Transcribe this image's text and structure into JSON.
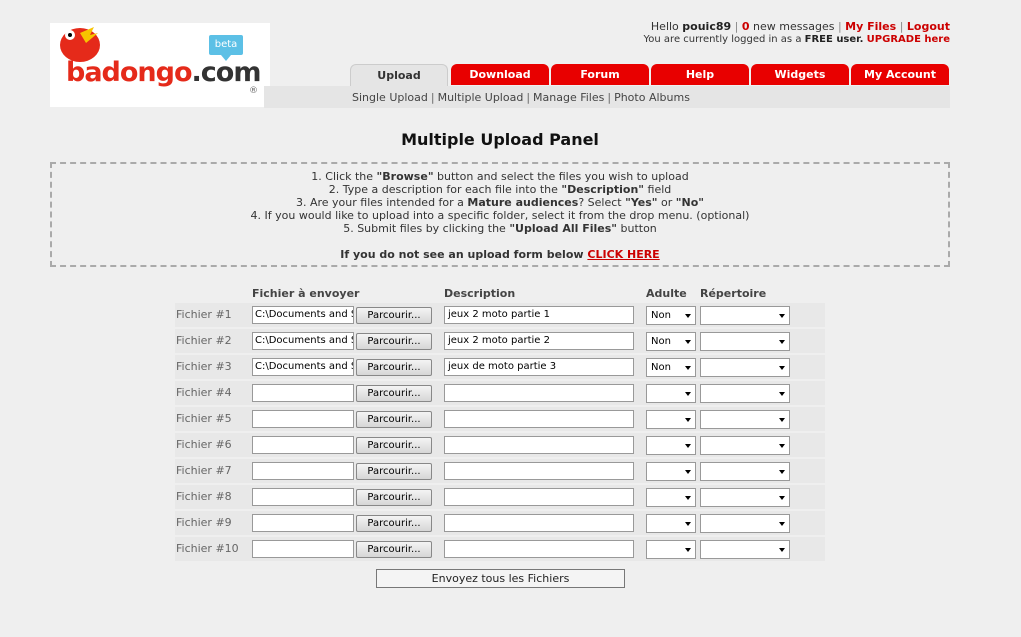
{
  "logo": {
    "text": "badongo",
    "suffix": ".com",
    "badge": "beta",
    "reg": "®"
  },
  "userbar": {
    "hello": "Hello",
    "username": "pouic89",
    "message_count": "0",
    "messages_label": "new messages",
    "my_files": "My Files",
    "logout": "Logout",
    "status_prefix": "You are currently logged in as a",
    "status_type": "FREE user.",
    "upgrade": "UPGRADE here"
  },
  "tabs": [
    {
      "label": "Upload",
      "active": true
    },
    {
      "label": "Download"
    },
    {
      "label": "Forum"
    },
    {
      "label": "Help"
    },
    {
      "label": "Widgets"
    },
    {
      "label": "My Account"
    }
  ],
  "subnav": [
    "Single Upload",
    "Multiple Upload",
    "Manage Files",
    "Photo Albums"
  ],
  "page_title": "Multiple Upload Panel",
  "instructions": {
    "line1_pre": "1. Click the ",
    "line1_b": "\"Browse\"",
    "line1_post": " button and select the files you wish to upload",
    "line2_pre": "2. Type a description for each file into the ",
    "line2_b": "\"Description\"",
    "line2_post": " field",
    "line3_pre": "3. Are your files intended for a ",
    "line3_b": "Mature audiences",
    "line3_mid": "? Select ",
    "line3_yes": "\"Yes\"",
    "line3_or": " or ",
    "line3_no": "\"No\"",
    "line4": "4. If you would like to upload into a specific folder, select it from the drop menu. (optional)",
    "line5_pre": "5. Submit files by clicking the ",
    "line5_b": "\"Upload All Files\"",
    "line5_post": " button",
    "notice": "If you do not see an upload form below",
    "click_here": "CLICK HERE"
  },
  "table": {
    "headers": {
      "file": "Fichier à envoyer",
      "description": "Description",
      "adult": "Adulte",
      "folder": "Répertoire"
    },
    "browse_label": "Parcourir...",
    "rows": [
      {
        "label": "Fichier #1",
        "file": "C:\\Documents and S",
        "description": "jeux 2 moto  partie 1",
        "adult": "Non"
      },
      {
        "label": "Fichier #2",
        "file": "C:\\Documents and S",
        "description": "jeux 2 moto partie 2",
        "adult": "Non"
      },
      {
        "label": "Fichier #3",
        "file": "C:\\Documents and S",
        "description": "jeux de moto partie 3",
        "adult": "Non"
      },
      {
        "label": "Fichier #4",
        "file": "",
        "description": "",
        "adult": ""
      },
      {
        "label": "Fichier #5",
        "file": "",
        "description": "",
        "adult": ""
      },
      {
        "label": "Fichier #6",
        "file": "",
        "description": "",
        "adult": ""
      },
      {
        "label": "Fichier #7",
        "file": "",
        "description": "",
        "adult": ""
      },
      {
        "label": "Fichier #8",
        "file": "",
        "description": "",
        "adult": ""
      },
      {
        "label": "Fichier #9",
        "file": "",
        "description": "",
        "adult": ""
      },
      {
        "label": "Fichier #10",
        "file": "",
        "description": "",
        "adult": ""
      }
    ]
  },
  "submit_label": "Envoyez tous les Fichiers"
}
